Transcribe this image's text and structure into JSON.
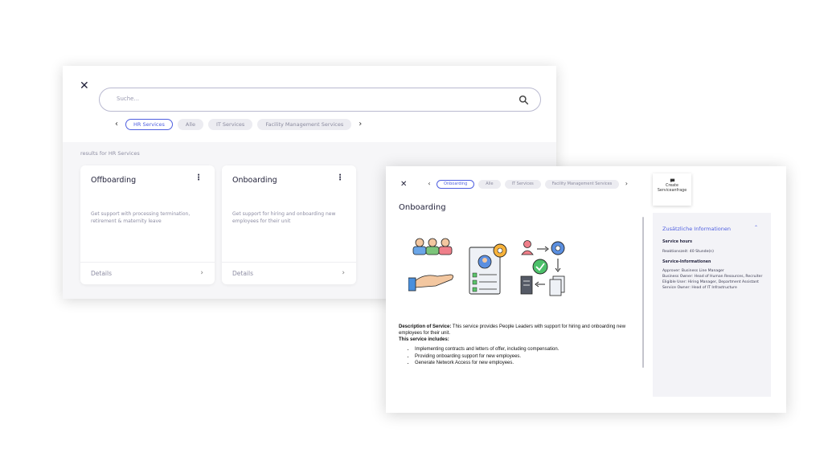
{
  "search": {
    "placeholder": "Suche..."
  },
  "back_window": {
    "chips": [
      "HR Services",
      "Alle",
      "IT Services",
      "Facility Management Services"
    ],
    "active_chip": 0,
    "results_label": "results for HR Services",
    "cards": [
      {
        "title": "Offboarding",
        "description": "Get support with processing termination, retirement & maternity leave",
        "details_label": "Details"
      },
      {
        "title": "Onboarding",
        "description": "Get support for hiring and onboarding new employees for their unit",
        "details_label": "Details"
      }
    ]
  },
  "front_window": {
    "chips": [
      "Onboarding",
      "Alle",
      "IT Services",
      "Facility Management Services"
    ],
    "active_chip": 0,
    "create_button": {
      "line1": "Create",
      "line2": "Serviceanfrage"
    },
    "title": "Onboarding",
    "description": {
      "label": "Description of Service:",
      "text": " This service provides People Leaders with support for hiring and onboarding new employees for their unit.",
      "includes_label": "This service includes:",
      "items": [
        "Implementing contracts and letters of offer, including compensation.",
        "Providing onboarding support for new employees.",
        "Generate Network Access for new employees."
      ]
    },
    "info_panel": {
      "heading": "Zusätzliche Informationen",
      "service_hours_label": "Service hours",
      "service_hours_value": "Reaktionszeit: 40 Stunde(n)",
      "service_info_label": "Service-Informationen",
      "service_info_lines": [
        "Approver: Business Line Manager",
        "Business Owner: Head of Human Resources, Recruiter",
        "Eligible User: Hiring Manager, Department Assistant",
        "Service Owner: Head of IT Infrastructure"
      ]
    }
  },
  "colors": {
    "accent": "#4f5fe0",
    "panel_bg": "#f3f3f7",
    "chip_bg": "#ececf1"
  }
}
